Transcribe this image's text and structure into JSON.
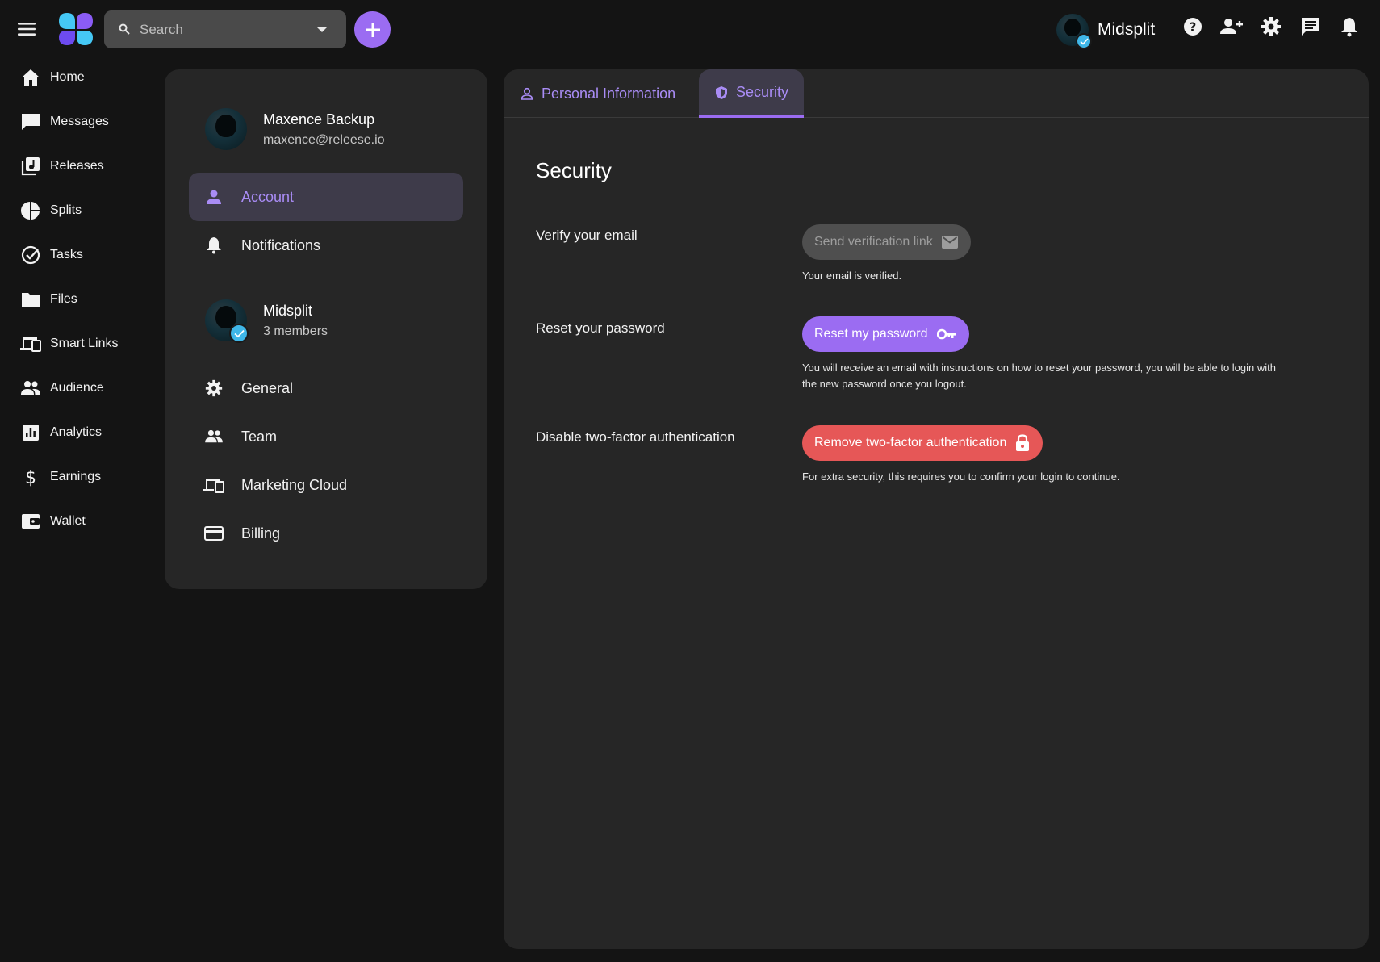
{
  "topbar": {
    "search_placeholder": "Search",
    "org_name": "Midsplit",
    "icons": [
      "menu-icon",
      "search-icon",
      "chevron-down-icon",
      "plus-icon",
      "help-icon",
      "add-user-icon",
      "gear-icon",
      "chat-icon",
      "bell-icon"
    ]
  },
  "sidebar": {
    "items": [
      {
        "label": "Home",
        "icon": "home-icon"
      },
      {
        "label": "Messages",
        "icon": "message-icon"
      },
      {
        "label": "Releases",
        "icon": "music-library-icon"
      },
      {
        "label": "Splits",
        "icon": "pie-chart-icon"
      },
      {
        "label": "Tasks",
        "icon": "check-circle-icon"
      },
      {
        "label": "Files",
        "icon": "folder-icon"
      },
      {
        "label": "Smart Links",
        "icon": "devices-icon"
      },
      {
        "label": "Audience",
        "icon": "people-icon"
      },
      {
        "label": "Analytics",
        "icon": "analytics-icon"
      },
      {
        "label": "Earnings",
        "icon": "dollar-icon"
      },
      {
        "label": "Wallet",
        "icon": "wallet-icon"
      }
    ]
  },
  "settings": {
    "user": {
      "name": "Maxence Backup",
      "email": "maxence@releese.io"
    },
    "user_items": [
      {
        "label": "Account",
        "icon": "person-icon",
        "active": true
      },
      {
        "label": "Notifications",
        "icon": "bell-icon",
        "active": false
      }
    ],
    "org": {
      "name": "Midsplit",
      "members": "3 members"
    },
    "org_items": [
      {
        "label": "General",
        "icon": "gear-icon"
      },
      {
        "label": "Team",
        "icon": "people-icon"
      },
      {
        "label": "Marketing Cloud",
        "icon": "devices-icon"
      },
      {
        "label": "Billing",
        "icon": "credit-card-icon"
      }
    ]
  },
  "main": {
    "tabs": [
      {
        "label": "Personal Information",
        "icon": "person-outline-icon",
        "active": false
      },
      {
        "label": "Security",
        "icon": "shield-icon",
        "active": true
      }
    ],
    "title": "Security",
    "rows": [
      {
        "label": "Verify your email",
        "button": "Send verification link",
        "button_icon": "mail-icon",
        "button_state": "disabled",
        "help": "Your email is verified."
      },
      {
        "label": "Reset your password",
        "button": "Reset my password",
        "button_icon": "key-icon",
        "button_state": "primary",
        "help": "You will receive an email with instructions on how to reset your password, you will be able to login with the new password once you logout."
      },
      {
        "label": "Disable two-factor authentication",
        "button": "Remove two-factor authentication",
        "button_icon": "lock-icon",
        "button_state": "danger",
        "help": "For extra security, this requires you to confirm your login to continue."
      }
    ]
  },
  "colors": {
    "background": "#141414",
    "card": "#262626",
    "accent": "#9b6cf2",
    "accent_text": "#a98cf5",
    "danger": "#e65757",
    "verified": "#3fb7e8"
  }
}
